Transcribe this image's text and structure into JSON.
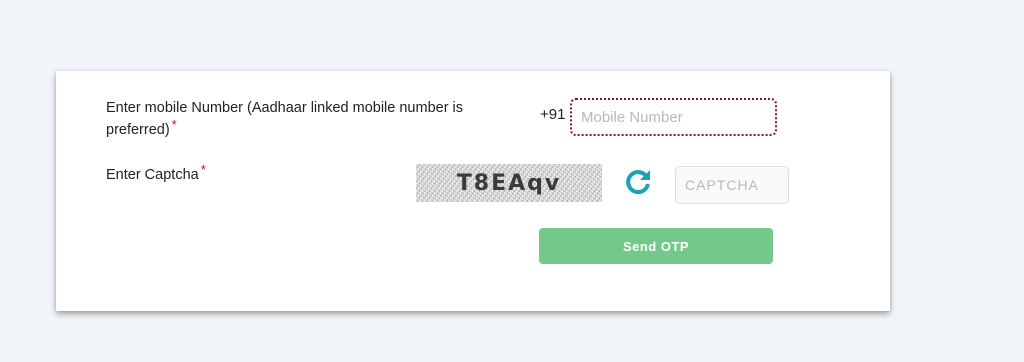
{
  "form": {
    "mobile_label": "Enter mobile Number (Aadhaar linked mobile number is preferred)",
    "required_mark": "*",
    "country_code": "+91",
    "mobile_value": "",
    "mobile_placeholder": "Mobile Number",
    "captcha_label": "Enter Captcha",
    "captcha_image_text": "T8EAqv",
    "refresh_icon": "refresh-icon",
    "captcha_value": "",
    "captcha_placeholder": "CAPTCHA",
    "send_otp_label": "Send OTP"
  },
  "colors": {
    "page_background": "#f2f6fa",
    "card_background": "#ffffff",
    "required": "#d0021b",
    "mobile_input_border": "#8a1538",
    "refresh_icon": "#1ba3b3",
    "send_button": "#73c98a"
  }
}
